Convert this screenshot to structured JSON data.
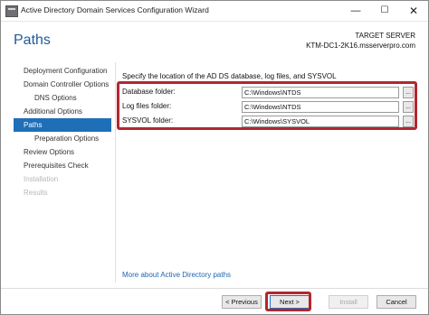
{
  "window": {
    "title": "Active Directory Domain Services Configuration Wizard",
    "minimize_glyph": "—",
    "maximize_glyph": "☐",
    "close_glyph": "✕"
  },
  "header": {
    "page_title": "Paths",
    "target_label": "TARGET SERVER",
    "target_server": "KTM-DC1-2K16.msserverpro.com"
  },
  "nav": {
    "items": [
      {
        "label": "Deployment Configuration",
        "state": "normal"
      },
      {
        "label": "Domain Controller Options",
        "state": "normal"
      },
      {
        "label": "DNS Options",
        "state": "sub"
      },
      {
        "label": "Additional Options",
        "state": "normal"
      },
      {
        "label": "Paths",
        "state": "active"
      },
      {
        "label": "Preparation Options",
        "state": "sub"
      },
      {
        "label": "Review Options",
        "state": "normal"
      },
      {
        "label": "Prerequisites Check",
        "state": "normal"
      },
      {
        "label": "Installation",
        "state": "disabled"
      },
      {
        "label": "Results",
        "state": "disabled"
      }
    ]
  },
  "main": {
    "intro": "Specify the location of the AD DS database, log files, and SYSVOL",
    "fields": {
      "database": {
        "label": "Database folder:",
        "value": "C:\\Windows\\NTDS",
        "browse": "..."
      },
      "logs": {
        "label": "Log files folder:",
        "value": "C:\\Windows\\NTDS",
        "browse": "..."
      },
      "sysvol": {
        "label": "SYSVOL folder:",
        "value": "C:\\Windows\\SYSVOL",
        "browse": "..."
      }
    },
    "more_link": "More about Active Directory paths"
  },
  "footer": {
    "previous": "< Previous",
    "next": "Next >",
    "install": "Install",
    "cancel": "Cancel"
  },
  "colors": {
    "accent": "#1f6fb8",
    "title_blue": "#1d5b9a",
    "highlight_red": "#b3262f",
    "link": "#1f64b0"
  }
}
